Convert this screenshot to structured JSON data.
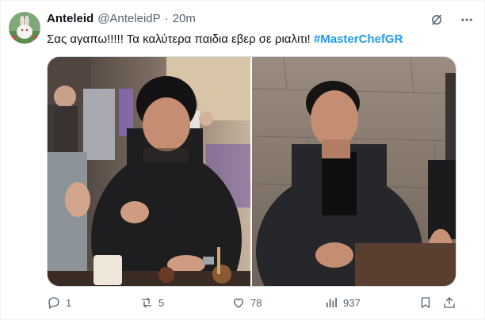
{
  "tweet": {
    "author_name": "Anteleid",
    "handle": "@AnteleidP",
    "separator": "·",
    "time": "20m",
    "text": "Σας αγαπω!!!!! Τα καλύτερα παιδια εβερ σε ριαλιτι!",
    "hashtag": "#MasterChefGR"
  },
  "icons": {
    "grok": "grok-icon",
    "more": "more-icon"
  },
  "actions": {
    "reply_count": "1",
    "repost_count": "5",
    "like_count": "78",
    "views_count": "937"
  },
  "colors": {
    "accent": "#1d9bf0",
    "secondary_text": "#536471",
    "primary_text": "#0f1419"
  }
}
